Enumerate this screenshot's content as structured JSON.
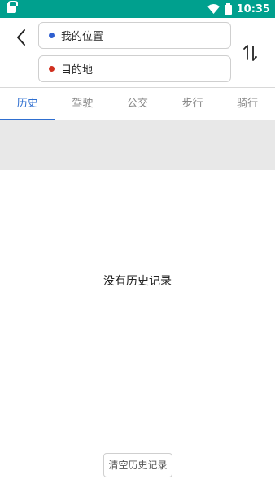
{
  "status_bar": {
    "time": "10:35",
    "bg_color": "#00a08e",
    "icons": [
      "app-icon",
      "wifi-icon",
      "battery-icon"
    ]
  },
  "header": {
    "back_icon": "chevron-left-icon",
    "start_field": {
      "value": "我的位置",
      "dot_color": "#2f5fd0"
    },
    "end_field": {
      "value": "目的地",
      "dot_color": "#d0301f"
    },
    "swap_icon": "swap-vertical-icon"
  },
  "tabs": [
    {
      "label": "历史",
      "active": true
    },
    {
      "label": "驾驶",
      "active": false
    },
    {
      "label": "公交",
      "active": false
    },
    {
      "label": "步行",
      "active": false
    },
    {
      "label": "骑行",
      "active": false
    }
  ],
  "accent_color": "#2f6fd0",
  "empty_state": {
    "text": "没有历史记录"
  },
  "clear_button": {
    "label": "清空历史记录"
  }
}
